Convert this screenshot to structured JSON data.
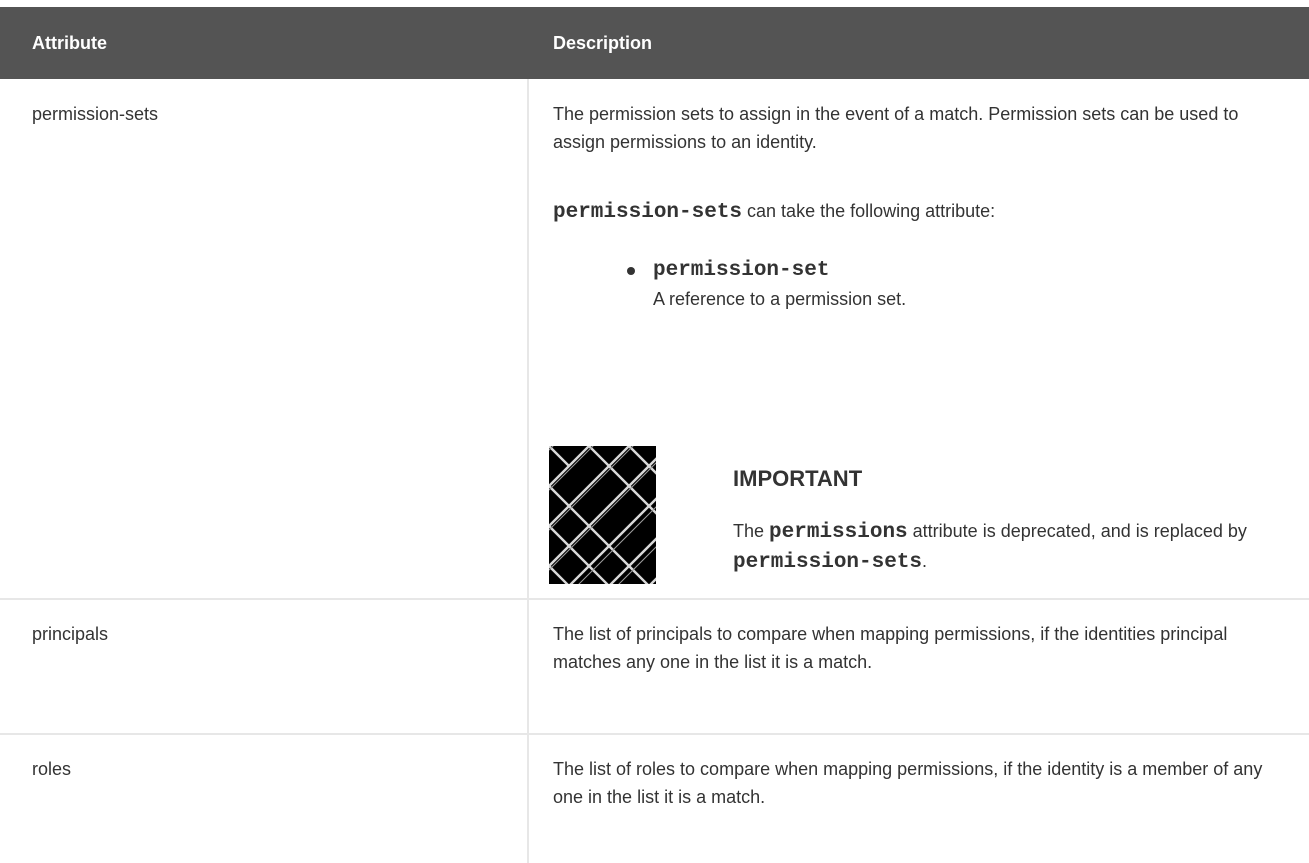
{
  "table": {
    "headers": {
      "attribute": "Attribute",
      "description": "Description"
    },
    "rows": [
      {
        "attribute": "permission-sets",
        "description": {
          "para1": "The permission sets to assign in the event of a match. Permission sets can be used to assign permissions to an identity.",
          "para2_code": "permission-sets",
          "para2_text": " can take the following attribute:",
          "items": [
            {
              "code": "permission-set",
              "text": "A reference to a permission set."
            }
          ],
          "admonition": {
            "icon": "important-pattern-icon",
            "title": "IMPORTANT",
            "text_pre": "The ",
            "code1": "permissions",
            "text_mid": " attribute is deprecated, and is replaced by ",
            "code2": "permission-sets",
            "text_post": "."
          }
        }
      },
      {
        "attribute": "principals",
        "description": "The list of principals to compare when mapping permissions, if the identities principal matches any one in the list it is a match."
      },
      {
        "attribute": "roles",
        "description": "The list of roles to compare when mapping permissions, if the identity is a member of any one in the list it is a match."
      }
    ]
  },
  "colors": {
    "header_bg": "#545454",
    "header_text": "#ffffff",
    "body_text": "#333333",
    "divider": "#e7e7e7"
  }
}
